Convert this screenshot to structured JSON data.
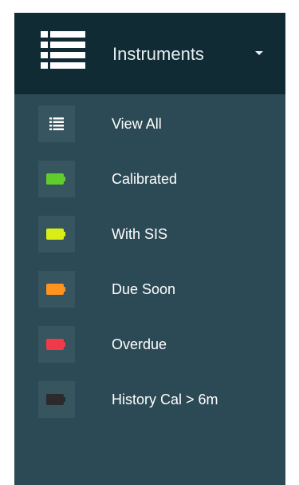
{
  "menu": {
    "title": "Instruments",
    "header_icon": "list-icon",
    "caret_icon": "caret-down-icon",
    "colors": {
      "header_bg": "#102b34",
      "panel_bg": "#2c4a55",
      "icon_box_bg": "#36555f",
      "text": "#ffffff"
    },
    "items": [
      {
        "label": "View All",
        "icon": "list-icon",
        "color": "#ffffff"
      },
      {
        "label": "Calibrated",
        "icon": "battery-green-icon",
        "color": "#5fce2c"
      },
      {
        "label": "With SIS",
        "icon": "battery-yellow-icon",
        "color": "#d9ee17"
      },
      {
        "label": "Due Soon",
        "icon": "battery-orange-icon",
        "color": "#ff931e"
      },
      {
        "label": "Overdue",
        "icon": "battery-red-icon",
        "color": "#f03a4a"
      },
      {
        "label": "History Cal > 6m",
        "icon": "battery-dark-icon",
        "color": "#2b2b2b"
      }
    ]
  }
}
